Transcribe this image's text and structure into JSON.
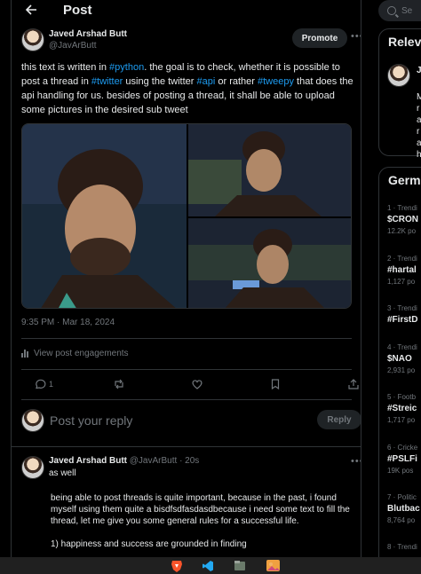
{
  "header": {
    "title": "Post"
  },
  "tweet": {
    "author_name": "Javed Arshad Butt",
    "author_handle": "@JavArButt",
    "promote_label": "Promote",
    "text_parts": [
      {
        "t": "this text is written in ",
        "h": false
      },
      {
        "t": "#python",
        "h": true
      },
      {
        "t": ". the goal is to check, whether it is possible to post a thread in ",
        "h": false
      },
      {
        "t": "#twitter",
        "h": true
      },
      {
        "t": " using the twitter ",
        "h": false
      },
      {
        "t": "#api",
        "h": true
      },
      {
        "t": " or rather ",
        "h": false
      },
      {
        "t": "#tweepy",
        "h": true
      },
      {
        "t": " that does the api handling for us. besides of posting a thread, it shall be able to upload some pictures in the desired sub tweet",
        "h": false
      }
    ],
    "timestamp": "9:35 PM · Mar 18, 2024",
    "engagements_label": "View post engagements",
    "reply_count": "1"
  },
  "reply_box": {
    "placeholder": "Post your reply",
    "button_label": "Reply"
  },
  "reply_tweet": {
    "author_name": "Javed Arshad Butt",
    "author_handle": "@JavArButt",
    "time": "· 20s",
    "subtitle": "as well",
    "paragraphs": [
      "being able to post threads is quite important, because in the past, i found myself using them quite a bisdfsdfasdasdbecause i need some text to fill the thread, let me give you some general rules for a successful life.",
      "1) happiness and success are grounded in finding"
    ]
  },
  "sidebar": {
    "search_placeholder": "Se",
    "relevant_title": "Relev",
    "relevant_initial": "J",
    "relevant_lines": [
      "M",
      "r",
      "a",
      "r",
      "a",
      "h"
    ],
    "trends_title": "Germ",
    "trends": [
      {
        "meta": "1 · Trendi",
        "name": "$CRON",
        "count": "12.2K po"
      },
      {
        "meta": "2 · Trendi",
        "name": "#hartal",
        "count": "1,127 po"
      },
      {
        "meta": "3 · Trendi",
        "name": "#FirstD",
        "count": ""
      },
      {
        "meta": "4 · Trendi",
        "name": "$NAO",
        "count": "2,931 po"
      },
      {
        "meta": "5 · Footb",
        "name": "#Streic",
        "count": "1,717 po"
      },
      {
        "meta": "6 · Cricke",
        "name": "#PSLFi",
        "count": "19K pos"
      },
      {
        "meta": "7 · Politic",
        "name": "Blutbac",
        "count": "8,764 po"
      },
      {
        "meta": "8 · Trendi",
        "name": "",
        "count": ""
      }
    ]
  },
  "taskbar": {
    "icons": [
      "brave-icon",
      "vscode-icon",
      "files-icon",
      "photos-icon"
    ]
  },
  "colors": {
    "accent": "#1d9bf0",
    "background": "#000000",
    "border": "#2f3336",
    "muted": "#71767b"
  }
}
